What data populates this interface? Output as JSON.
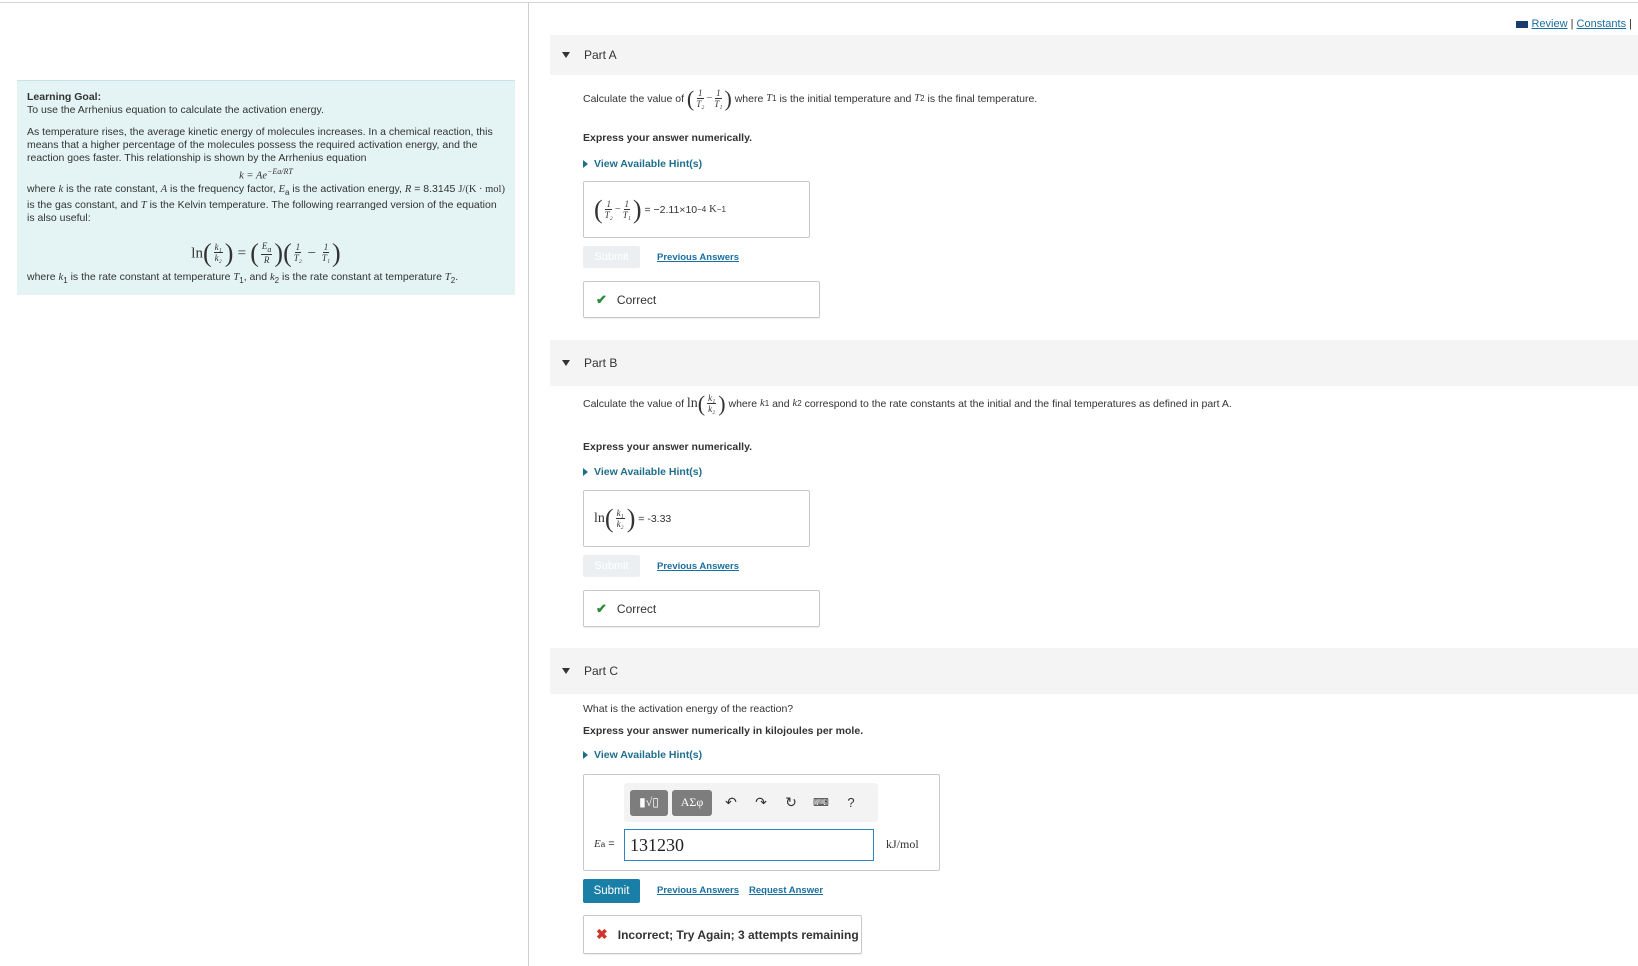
{
  "top_links": {
    "review": "Review",
    "separator": "|",
    "constants": "Constants",
    "trailing": "|"
  },
  "goal": {
    "title": "Learning Goal:",
    "subtitle": "To use the Arrhenius equation to calculate the activation energy.",
    "para1": "As temperature rises, the average kinetic energy of molecules increases. In a chemical reaction, this means that a higher percentage of the molecules possess the required activation energy, and the reaction goes faster. This relationship is shown by the Arrhenius equation",
    "eq1_lhs": "k = Ae",
    "eq1_exp": "−Ea/RT",
    "para2_a": "where",
    "para2_k": "k",
    "para2_b": "is the rate constant,",
    "para2_A": "A",
    "para2_c": "is the frequency factor,",
    "para2_Ea": "E",
    "para2_d": "is the activation energy,",
    "para2_R": "R",
    "para2_e": "= 8.3145",
    "para2_units": "J/(K · mol)",
    "para2_f": "is the gas constant, and",
    "para2_T": "T",
    "para2_g": "is the Kelvin temperature. The following rearranged version of the equation is also useful:",
    "para3_a": "where",
    "para3_b": "is the rate constant at temperature",
    "para3_c": ", and",
    "para3_d": "is the rate constant at temperature"
  },
  "partA": {
    "title": "Part A",
    "question_pre": "Calculate the value of",
    "question_post_a": "where",
    "question_post_b": "is the initial temperature and",
    "question_post_c": "is the final temperature.",
    "express": "Express your answer numerically.",
    "hint": "View Available Hint(s)",
    "answer": "= −2.11×10",
    "answer_exp": "−4",
    "answer_unit": "K",
    "answer_unit_exp": "−1",
    "submit": "Submit",
    "previous": "Previous Answers",
    "feedback": "Correct"
  },
  "partB": {
    "title": "Part B",
    "question_pre": "Calculate the value of",
    "question_post_a": "where",
    "question_post_b": "and",
    "question_post_c": "correspond to the rate constants at the initial and the final temperatures as defined in part A.",
    "express": "Express your answer numerically.",
    "hint": "View Available Hint(s)",
    "answer": "= -3.33",
    "submit": "Submit",
    "previous": "Previous Answers",
    "feedback": "Correct"
  },
  "partC": {
    "title": "Part C",
    "question": "What is the activation energy of the reaction?",
    "express": "Express your answer numerically in kilojoules per mole.",
    "hint": "View Available Hint(s)",
    "templates_btn": "▮√▯",
    "symbols_btn": "ΑΣφ",
    "help": "?",
    "input_label": "= ",
    "input_value": "131230",
    "unit": "kJ/mol",
    "submit": "Submit",
    "previous": "Previous Answers",
    "request": "Request Answer",
    "feedback": "Incorrect; Try Again; 3 attempts remaining"
  }
}
